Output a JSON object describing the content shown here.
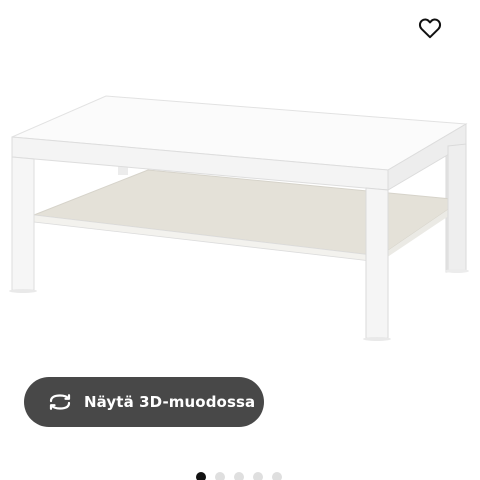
{
  "product": {
    "image_alt": "White coffee table with lower shelf",
    "view_3d_label": "Näytä 3D-muodossa"
  },
  "icons": {
    "favorite": "heart-outline-icon",
    "view_3d": "rotate-3d-icon"
  },
  "carousel": {
    "total_slides": 5,
    "active_index": 0
  },
  "colors": {
    "button_background": "#484848",
    "button_text": "#ffffff",
    "dot_active": "#111111",
    "dot_inactive": "#dfdfdf"
  }
}
